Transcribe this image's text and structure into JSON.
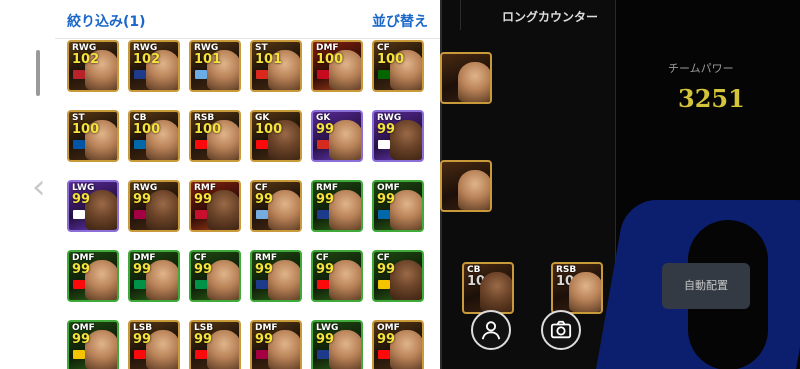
{
  "header": {
    "filter_label": "絞り込み(1)",
    "sort_label": "並び替え"
  },
  "field": {
    "mode_title": "ロングカウンター",
    "team_power_label": "チームパワー",
    "team_power_value": "3251",
    "auto_button": "自動配置",
    "cards": [
      {
        "pos": "CB",
        "rating": "104"
      },
      {
        "pos": "RSB",
        "rating": "103"
      }
    ]
  },
  "players": [
    {
      "pos": "RWG",
      "rating": "102",
      "style": "epic",
      "flag": "#b8232a",
      "skin": "light"
    },
    {
      "pos": "RWG",
      "rating": "102",
      "style": "epic",
      "flag": "#1e3a8a",
      "skin": "light"
    },
    {
      "pos": "RWG",
      "rating": "101",
      "style": "epic",
      "flag": "#6cace4",
      "skin": "light"
    },
    {
      "pos": "ST",
      "rating": "101",
      "style": "epic",
      "flag": "#da291c",
      "skin": "light"
    },
    {
      "pos": "DMF",
      "rating": "100",
      "style": "red",
      "flag": "#c60b1e",
      "skin": "light"
    },
    {
      "pos": "CF",
      "rating": "100",
      "style": "epic",
      "flag": "#006600",
      "skin": "light"
    },
    {
      "pos": "ST",
      "rating": "100",
      "style": "epic",
      "flag": "#0055a4",
      "skin": "light"
    },
    {
      "pos": "CB",
      "rating": "100",
      "style": "epic",
      "flag": "#0068a8",
      "skin": "light"
    },
    {
      "pos": "RSB",
      "rating": "100",
      "style": "epic",
      "flag": "#fb090b",
      "skin": "light"
    },
    {
      "pos": "GK",
      "rating": "100",
      "style": "epic",
      "flag": "#fb090b",
      "skin": "dark"
    },
    {
      "pos": "GK",
      "rating": "99",
      "style": "purple",
      "flag": "#d52b1e",
      "skin": "light"
    },
    {
      "pos": "RWG",
      "rating": "99",
      "style": "purple",
      "flag": "#ffffff",
      "skin": "dark"
    },
    {
      "pos": "LWG",
      "rating": "99",
      "style": "purple",
      "flag": "#ffffff",
      "skin": "dark"
    },
    {
      "pos": "RWG",
      "rating": "99",
      "style": "epic",
      "flag": "#a50044",
      "skin": "dark"
    },
    {
      "pos": "RMF",
      "rating": "99",
      "style": "red",
      "flag": "#c8102e",
      "skin": "dark"
    },
    {
      "pos": "CF",
      "rating": "99",
      "style": "epic",
      "flag": "#74acdf",
      "skin": "light"
    },
    {
      "pos": "RMF",
      "rating": "99",
      "style": "green",
      "flag": "#1e3a8a",
      "skin": "light"
    },
    {
      "pos": "OMF",
      "rating": "99",
      "style": "green",
      "flag": "#0068a8",
      "skin": "light"
    },
    {
      "pos": "DMF",
      "rating": "99",
      "style": "green",
      "flag": "#fb090b",
      "skin": "light"
    },
    {
      "pos": "DMF",
      "rating": "99",
      "style": "green",
      "flag": "#009246",
      "skin": "light"
    },
    {
      "pos": "CF",
      "rating": "99",
      "style": "green",
      "flag": "#009246",
      "skin": "light"
    },
    {
      "pos": "RMF",
      "rating": "99",
      "style": "green",
      "flag": "#1e3a8a",
      "skin": "light"
    },
    {
      "pos": "CF",
      "rating": "99",
      "style": "green",
      "flag": "#fb090b",
      "skin": "light"
    },
    {
      "pos": "CF",
      "rating": "99",
      "style": "green",
      "flag": "#f5c400",
      "skin": "dark"
    },
    {
      "pos": "OMF",
      "rating": "99",
      "style": "green",
      "flag": "#f5c400",
      "skin": "light"
    },
    {
      "pos": "LSB",
      "rating": "99",
      "style": "epic",
      "flag": "#fb090b",
      "skin": "light"
    },
    {
      "pos": "LSB",
      "rating": "99",
      "style": "epic",
      "flag": "#fb090b",
      "skin": "light"
    },
    {
      "pos": "DMF",
      "rating": "99",
      "style": "epic",
      "flag": "#a50044",
      "skin": "light"
    },
    {
      "pos": "LWG",
      "rating": "99",
      "style": "green",
      "flag": "#1e3a8a",
      "skin": "light"
    },
    {
      "pos": "OMF",
      "rating": "99",
      "style": "epic",
      "flag": "#fb090b",
      "skin": "light"
    }
  ]
}
